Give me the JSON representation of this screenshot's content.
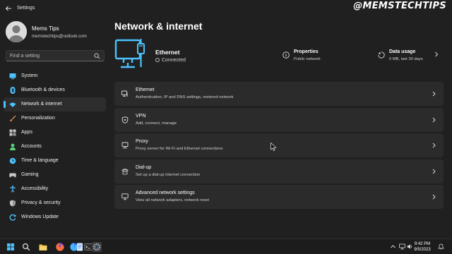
{
  "window": {
    "title": "Settings"
  },
  "watermark": "@MEMSTECHTIPS",
  "profile": {
    "name": "Mems Tips",
    "email": "memstechtips@outlook.com"
  },
  "search": {
    "placeholder": "Find a setting"
  },
  "sidebar": {
    "items": [
      {
        "label": "System",
        "icon": "system-icon",
        "color": "#4cc2ff"
      },
      {
        "label": "Bluetooth & devices",
        "icon": "bluetooth-icon",
        "color": "#4cc2ff"
      },
      {
        "label": "Network & internet",
        "icon": "wifi-icon",
        "color": "#4cc2ff",
        "selected": true
      },
      {
        "label": "Personalization",
        "icon": "brush-icon",
        "color": "#e8a35f"
      },
      {
        "label": "Apps",
        "icon": "apps-icon",
        "color": "#c6c6c6"
      },
      {
        "label": "Accounts",
        "icon": "person-icon",
        "color": "#5ad37a"
      },
      {
        "label": "Time & language",
        "icon": "globe-clock-icon",
        "color": "#4cc2ff"
      },
      {
        "label": "Gaming",
        "icon": "controller-icon",
        "color": "#c6c6c6"
      },
      {
        "label": "Accessibility",
        "icon": "accessibility-icon",
        "color": "#4cc2ff"
      },
      {
        "label": "Privacy & security",
        "icon": "shield-icon",
        "color": "#b0b0b0"
      },
      {
        "label": "Windows Update",
        "icon": "update-icon",
        "color": "#4cc2ff"
      }
    ]
  },
  "main": {
    "title": "Network & internet",
    "hero": {
      "connection_title": "Ethernet",
      "connection_status": "Connected",
      "properties": {
        "title": "Properties",
        "subtitle": "Public network"
      },
      "data_usage": {
        "title": "Data usage",
        "subtitle": "0 MB, last 30 days"
      }
    },
    "cards": [
      {
        "title": "Ethernet",
        "subtitle": "Authentication, IP and DNS settings, metered network",
        "icon": "ethernet-icon"
      },
      {
        "title": "VPN",
        "subtitle": "Add, connect, manage",
        "icon": "vpn-shield-icon"
      },
      {
        "title": "Proxy",
        "subtitle": "Proxy server for Wi-Fi and Ethernet connections",
        "icon": "proxy-icon"
      },
      {
        "title": "Dial-up",
        "subtitle": "Set up a dial-up internet connection",
        "icon": "dialup-icon"
      },
      {
        "title": "Advanced network settings",
        "subtitle": "View all network adapters, network reset",
        "icon": "network-pc-icon"
      }
    ]
  },
  "taskbar": {
    "time": "9:42 PM",
    "date": "9/5/2023",
    "apps": [
      "start-icon",
      "search-icon",
      "file-explorer-icon",
      "firefox-icon",
      "firefox-dev-icon",
      "notepad-icon",
      "terminal-icon",
      "settings-icon"
    ]
  },
  "colors": {
    "accent": "#4cc2ff",
    "background": "#202020",
    "card": "#2b2b2b"
  }
}
